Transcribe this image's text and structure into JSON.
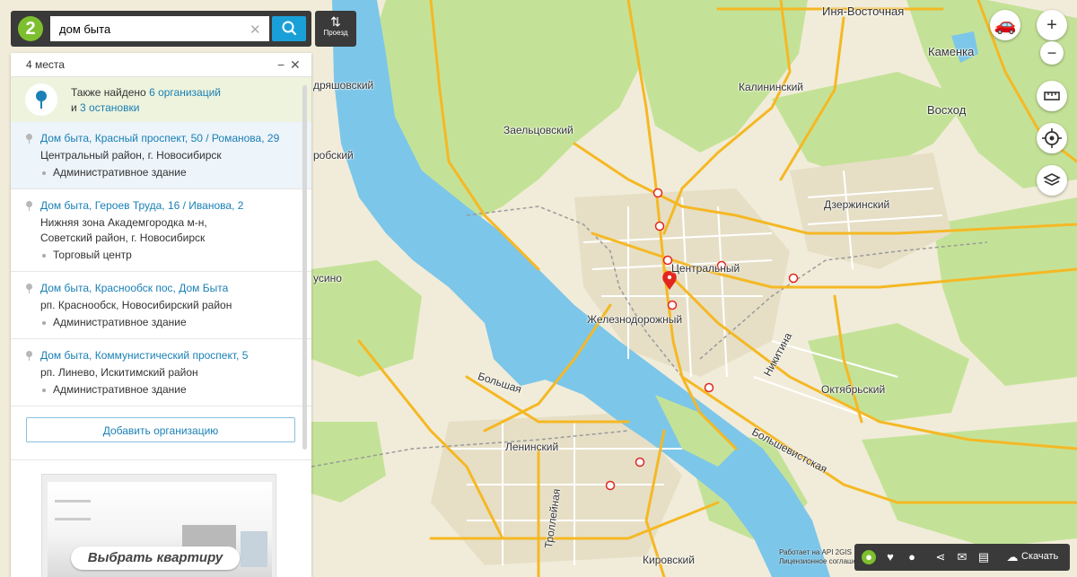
{
  "search": {
    "value": "дом быта",
    "route_label": "Проезд"
  },
  "panel": {
    "count_label": "4 места",
    "also_found": {
      "prefix": "Также найдено",
      "orgs_link": "6 организаций",
      "and": "и",
      "stops_link": "3 остановки"
    },
    "results": [
      {
        "title": "Дом быта, Красный проспект, 50 / Романова, 29",
        "address": [
          "Центральный район, г. Новосибирск"
        ],
        "category": "Административное здание"
      },
      {
        "title": "Дом быта, Героев Труда, 16 / Иванова, 2",
        "address": [
          "Нижняя зона Академгородка м-н,",
          "Советский район, г. Новосибирск"
        ],
        "category": "Торговый центр"
      },
      {
        "title": "Дом быта, Краснообск пос, Дом Быта",
        "address": [
          "рп. Краснообск, Новосибирский район"
        ],
        "category": "Административное здание"
      },
      {
        "title": "Дом быта, Коммунистический проспект, 5",
        "address": [
          "рп. Линево, Искитимский район"
        ],
        "category": "Административное здание"
      }
    ],
    "add_org_label": "Добавить организацию",
    "ad_label": "Выбрать квартиру"
  },
  "map": {
    "districts": {
      "inya": "Иня-Восточная",
      "kamenka": "Каменка",
      "voskhod": "Восход",
      "kalininsky": "Калининский",
      "zaeltsovsky": "Заельцовский",
      "dzerzhinsky": "Дзержинский",
      "centralny": "Центральный",
      "zheleznodorozhny": "Железнодорожный",
      "oktyabrsky": "Октябрьский",
      "leninsky": "Ленинский",
      "kirovsky": "Кировский",
      "andryashovsky": "дряшовский",
      "orobsky": "робский",
      "usino": "усино"
    },
    "streets": {
      "bolshaya": "Большая",
      "nikitina": "Никитина",
      "bolshevistskaya": "Большевистская",
      "troleynaya": "Троллейная"
    },
    "attribution": [
      "Работает на API 2GIS",
      "Лицензионное соглашение"
    ],
    "download_label": "Скачать"
  },
  "icons": {
    "search": "search-icon",
    "clear": "close-icon",
    "route": "route-icon",
    "traffic": "traffic-car-icon",
    "zoom_in": "plus-icon",
    "zoom_out": "minus-icon",
    "ruler": "ruler-icon",
    "geolocation": "target-icon",
    "layers": "layers-icon",
    "marker": "map-pin-icon"
  },
  "colors": {
    "accent_blue": "#1aa0d8",
    "link_blue": "#1a80b6",
    "marker_red": "#e3261d",
    "toolbar_dark": "#3a3a3a",
    "river": "#7cc6e9",
    "road_yellow": "#f5b824",
    "green": "#bfe08a"
  }
}
